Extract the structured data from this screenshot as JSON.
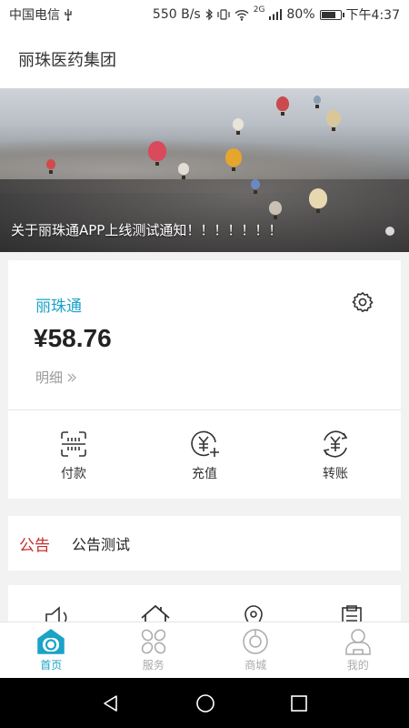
{
  "status_bar": {
    "carrier": "中国电信",
    "speed": "550 B/s",
    "network": "2G",
    "battery": "80%",
    "battery_level": 0.8,
    "time": "下午4:37"
  },
  "header": {
    "title": "丽珠医药集团"
  },
  "banner": {
    "caption": "关于丽珠通APP上线测试通知！！！！！！！"
  },
  "wallet": {
    "name": "丽珠通",
    "balance": "¥58.76",
    "detail_label": "明细",
    "actions": [
      {
        "label": "付款",
        "icon": "barcode-scan-icon"
      },
      {
        "label": "充值",
        "icon": "yuan-plus-icon"
      },
      {
        "label": "转账",
        "icon": "yuan-transfer-icon"
      }
    ]
  },
  "notice": {
    "tag": "公告",
    "text": "公告测试"
  },
  "tabs": [
    {
      "label": "首页",
      "icon": "home-icon",
      "active": true
    },
    {
      "label": "服务",
      "icon": "service-icon",
      "active": false
    },
    {
      "label": "商城",
      "icon": "mall-icon",
      "active": false
    },
    {
      "label": "我的",
      "icon": "profile-icon",
      "active": false
    }
  ],
  "colors": {
    "accent": "#1aa3c7",
    "notice_tag": "#c62d2d",
    "tab_inactive": "#aaaaaa"
  }
}
